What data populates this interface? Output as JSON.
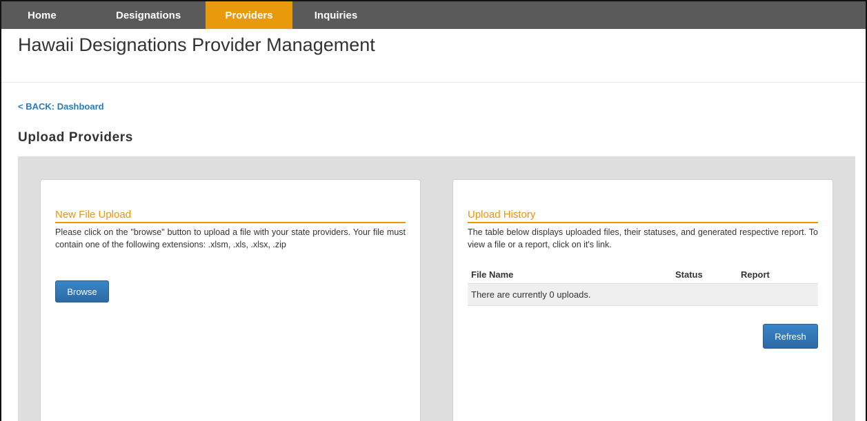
{
  "nav": {
    "items": [
      {
        "label": "Home",
        "active": false
      },
      {
        "label": "Designations",
        "active": false
      },
      {
        "label": "Providers",
        "active": true
      },
      {
        "label": "Inquiries",
        "active": false
      }
    ],
    "active_color": "#e89a0c",
    "bar_color": "#5a5a5a"
  },
  "header": {
    "title": "Hawaii Designations Provider Management"
  },
  "back_link": "< BACK: Dashboard",
  "page_title": "Upload Providers",
  "upload_panel": {
    "heading": "New File Upload",
    "description": "Please click on the \"browse\" button to upload a file with your state providers. Your file must contain one of the following extensions: .xlsm, .xls, .xlsx, .zip",
    "browse_label": "Browse"
  },
  "history_panel": {
    "heading": "Upload History",
    "description": "The table below displays uploaded files, their statuses, and generated respective report. To view a file or a report, click on it's link.",
    "columns": [
      "File Name",
      "Status",
      "Report"
    ],
    "empty_message": "There are currently 0 uploads.",
    "refresh_label": "Refresh"
  },
  "colors": {
    "accent": "#e8960c",
    "link": "#2a7ab8",
    "button": "#2b6aa5"
  }
}
